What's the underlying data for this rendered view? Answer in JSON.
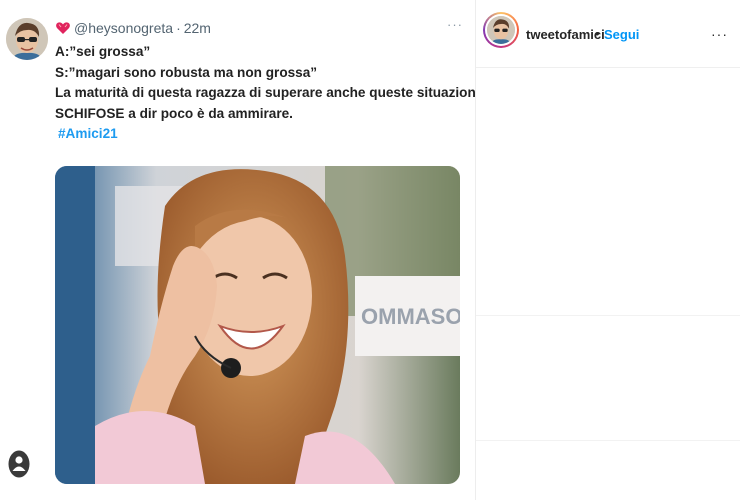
{
  "tweet": {
    "handle": "@heysonogreta",
    "separator": "·",
    "time": "22m",
    "more": "···",
    "lines": [
      "A:”sei grossa”",
      "S:”magari sono robusta ma non grossa”",
      "La maturità di questa ragazza di superare anche queste situazioni",
      "SCHIFOSE a dir poco è da ammirare."
    ],
    "hashtag": "#Amici21",
    "photo_sign_text": "OMMASO"
  },
  "instagram": {
    "username": "tweetofamici",
    "dot": "•",
    "follow_label": "Segui",
    "more": "···"
  },
  "colors": {
    "hashtag": "#1d9bf0",
    "follow": "#0095f6",
    "secondary_text": "#536471"
  },
  "icons": {
    "verified_badge": "red-heart-badge-icon",
    "more_tweet": "more-horizontal-icon",
    "more_post": "more-horizontal-icon",
    "user": "user-profile-icon"
  }
}
